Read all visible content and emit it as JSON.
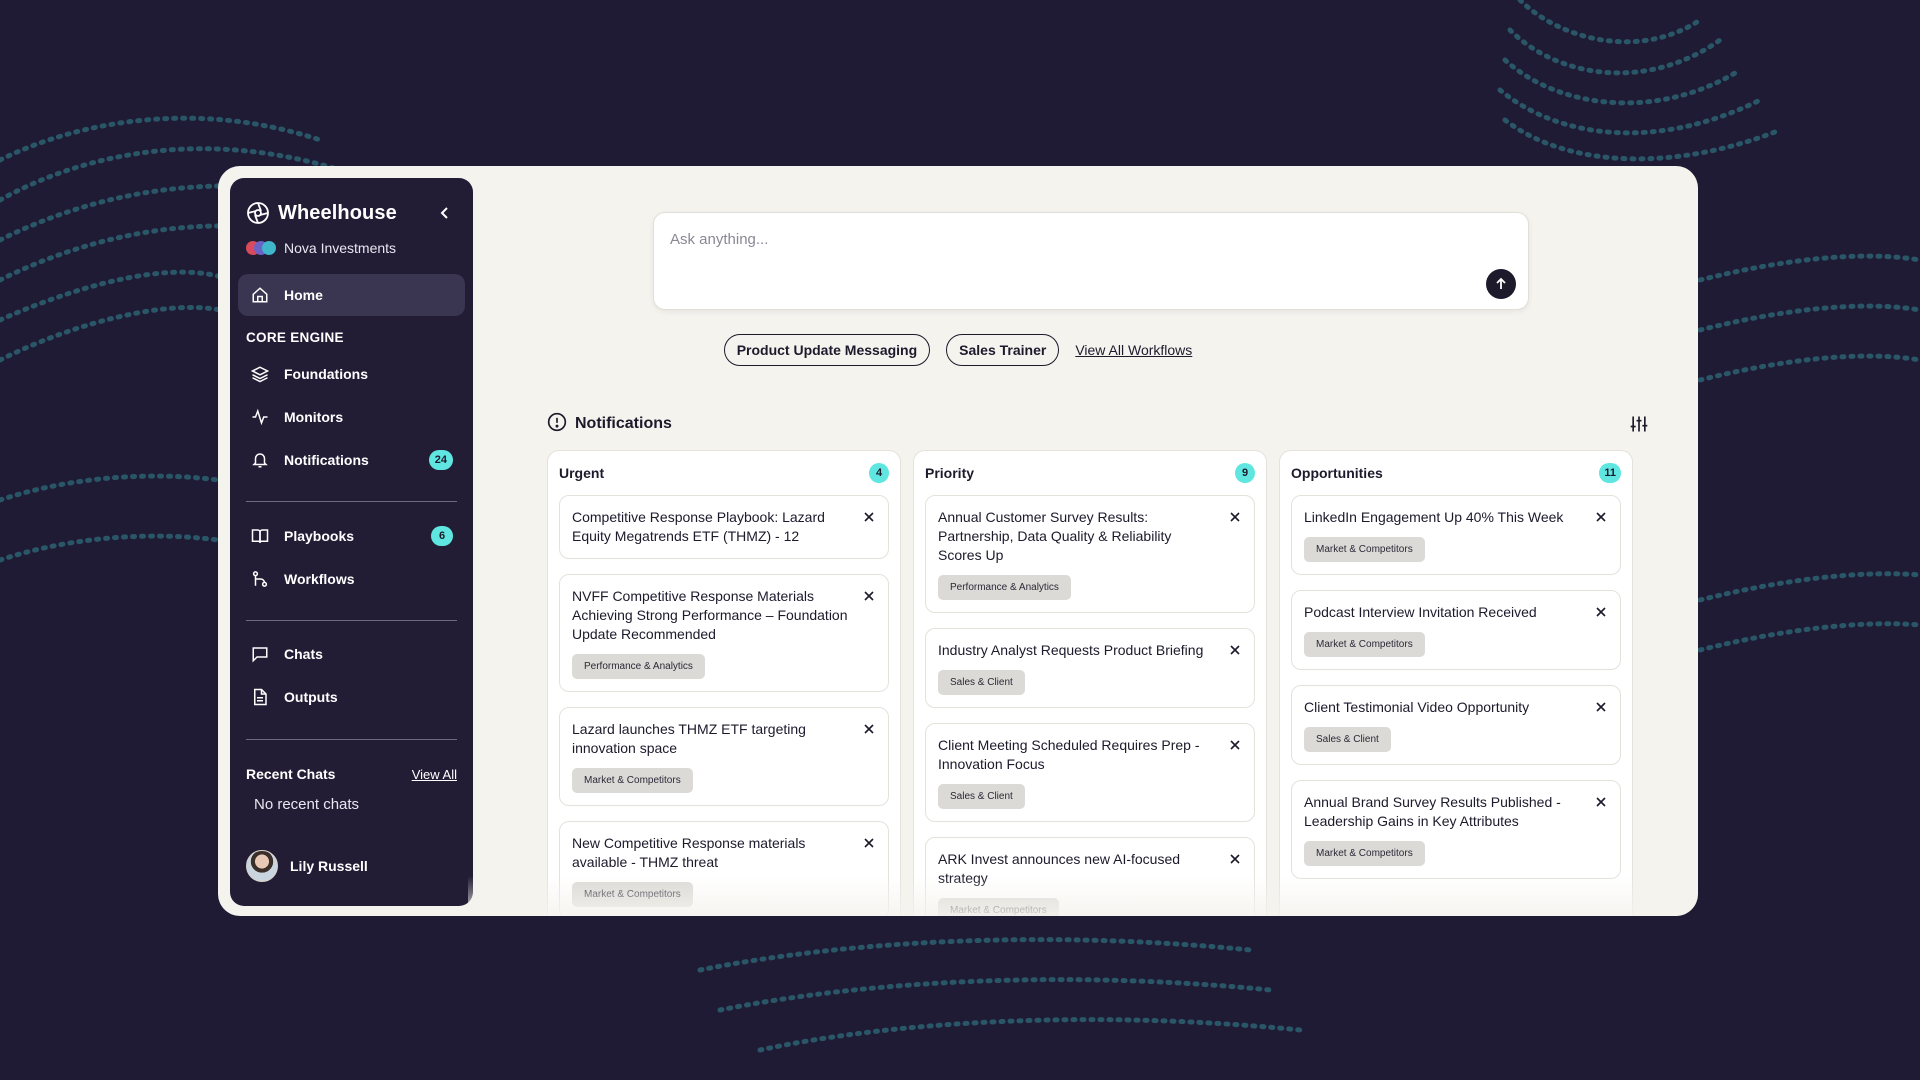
{
  "brand": {
    "name": "Wheelhouse",
    "org": "Nova Investments"
  },
  "nav": {
    "home": "Home",
    "section_core": "CORE ENGINE",
    "foundations": "Foundations",
    "monitors": "Monitors",
    "notifications": "Notifications",
    "notifications_badge": "24",
    "playbooks": "Playbooks",
    "playbooks_badge": "6",
    "workflows": "Workflows",
    "chats": "Chats",
    "outputs": "Outputs"
  },
  "recent_chats": {
    "title": "Recent Chats",
    "view_all": "View All",
    "empty": "No recent chats"
  },
  "user": {
    "name": "Lily Russell"
  },
  "ask": {
    "placeholder": "Ask anything..."
  },
  "workflows": {
    "chips": [
      "Product Update Messaging",
      "Sales Trainer"
    ],
    "view_all": "View All Workflows"
  },
  "notifications": {
    "title": "Notifications",
    "columns": [
      {
        "title": "Urgent",
        "count": "4",
        "cards": [
          {
            "title": "Competitive Response Playbook: Lazard Equity Megatrends ETF (THMZ) - 12",
            "tag": ""
          },
          {
            "title": "NVFF Competitive Response Materials Achieving Strong Performance – Foundation Update Recommended",
            "tag": "Performance & Analytics"
          },
          {
            "title": "Lazard launches THMZ ETF targeting innovation space",
            "tag": "Market & Competitors"
          },
          {
            "title": "New Competitive Response materials available - THMZ threat",
            "tag": "Market & Competitors"
          }
        ]
      },
      {
        "title": "Priority",
        "count": "9",
        "cards": [
          {
            "title": "Annual Customer Survey Results: Partnership, Data Quality & Reliability Scores Up",
            "tag": "Performance & Analytics"
          },
          {
            "title": "Industry Analyst Requests Product Briefing",
            "tag": "Sales & Client"
          },
          {
            "title": "Client Meeting Scheduled Requires Prep - Innovation Focus",
            "tag": "Sales & Client"
          },
          {
            "title": "ARK Invest announces new AI-focused strategy",
            "tag": "Market & Competitors"
          }
        ]
      },
      {
        "title": "Opportunities",
        "count": "11",
        "cards": [
          {
            "title": "LinkedIn Engagement Up 40% This Week",
            "tag": "Market & Competitors"
          },
          {
            "title": "Podcast Interview Invitation Received",
            "tag": "Market & Competitors"
          },
          {
            "title": "Client Testimonial Video Opportunity",
            "tag": "Sales & Client"
          },
          {
            "title": "Annual Brand Survey Results Published - Leadership Gains in Key Attributes",
            "tag": "Market & Competitors"
          }
        ]
      }
    ]
  },
  "colors": {
    "background": "#1f1b35",
    "sidebar": "#221d35",
    "accent_badge": "#5fe6e0",
    "panel": "#f5f3ee"
  }
}
